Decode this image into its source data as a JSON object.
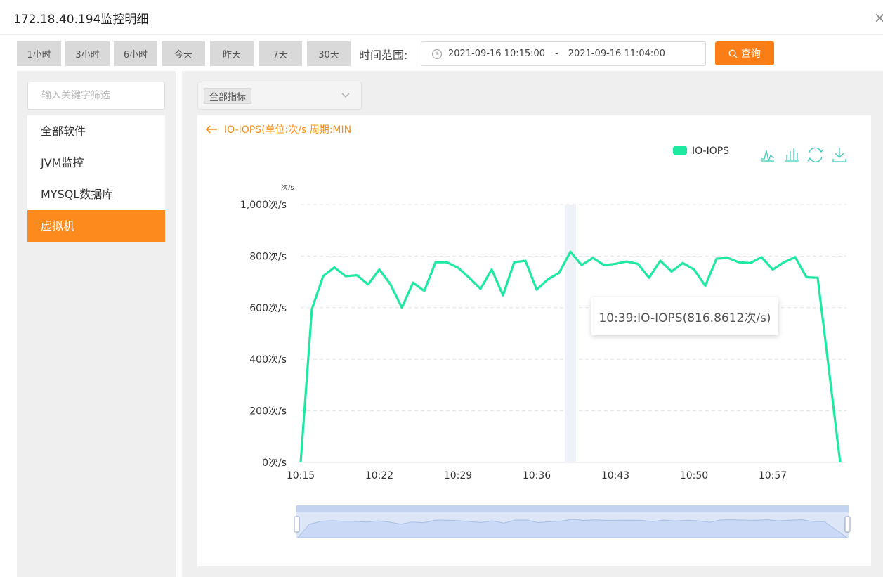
{
  "title": "172.18.40.194监控明细",
  "close_icon": "×",
  "quick_ranges": [
    "1小时",
    "3小时",
    "6小时",
    "今天",
    "昨天",
    "7天",
    "30天"
  ],
  "time_range": {
    "label": "时间范围:",
    "start": "2021-09-16 10:15:00",
    "separator": "-",
    "end": "2021-09-16 11:04:00"
  },
  "query_button": "查询",
  "sidebar": {
    "search_placeholder": "输入关键字筛选",
    "items": [
      {
        "label": "全部软件",
        "active": false
      },
      {
        "label": "JVM监控",
        "active": false
      },
      {
        "label": "MYSQL数据库",
        "active": false
      },
      {
        "label": "虚拟机",
        "active": true
      }
    ]
  },
  "metric_filter": {
    "selected": "全部指标"
  },
  "chart_header": {
    "title": "IO-IOPS(单位:次/s 周期:MIN"
  },
  "toolbar_icons": [
    "line-chart-icon",
    "bar-chart-icon",
    "refresh-icon",
    "download-icon"
  ],
  "colors": {
    "accent": "#fa7d16",
    "series": "#1de9a0",
    "toolbar": "#3ccdbd",
    "active_menu": "#fd8a1c"
  },
  "tooltip": {
    "text": "10:39:IO-IOPS(816.8612次/s)"
  },
  "chart_data": {
    "type": "line",
    "unit_label": "次/s",
    "legend": {
      "entries": [
        "IO-IOPS"
      ],
      "position": "top-right"
    },
    "x": [
      "10:15",
      "10:16",
      "10:17",
      "10:18",
      "10:19",
      "10:20",
      "10:21",
      "10:22",
      "10:23",
      "10:24",
      "10:25",
      "10:26",
      "10:27",
      "10:28",
      "10:29",
      "10:30",
      "10:31",
      "10:32",
      "10:33",
      "10:34",
      "10:35",
      "10:36",
      "10:37",
      "10:38",
      "10:39",
      "10:40",
      "10:41",
      "10:42",
      "10:43",
      "10:44",
      "10:45",
      "10:46",
      "10:47",
      "10:48",
      "10:49",
      "10:50",
      "10:51",
      "10:52",
      "10:53",
      "10:54",
      "10:55",
      "10:56",
      "10:57",
      "10:58",
      "10:59",
      "11:00",
      "11:01",
      "11:02",
      "11:03",
      "11:04"
    ],
    "x_ticks": [
      "10:15",
      "10:22",
      "10:29",
      "10:36",
      "10:43",
      "10:50",
      "10:57"
    ],
    "y_ticks": [
      "0次/s",
      "200次/s",
      "400次/s",
      "600次/s",
      "800次/s",
      "1,000次/s"
    ],
    "ylim": [
      0,
      1000
    ],
    "grid": true,
    "series": [
      {
        "name": "IO-IOPS",
        "values": [
          0,
          595,
          722,
          756,
          722,
          726,
          690,
          748,
          690,
          600,
          697,
          665,
          776,
          776,
          755,
          716,
          673,
          748,
          648,
          776,
          782,
          670,
          710,
          735,
          816.8612,
          765,
          793,
          765,
          770,
          779,
          770,
          716,
          782,
          740,
          773,
          748,
          685,
          790,
          793,
          776,
          773,
          796,
          748,
          776,
          796,
          718,
          716,
          360,
          0
        ]
      }
    ],
    "highlight_x": "10:39",
    "zoom_slider": {
      "start_pct": 0,
      "end_pct": 100
    }
  }
}
